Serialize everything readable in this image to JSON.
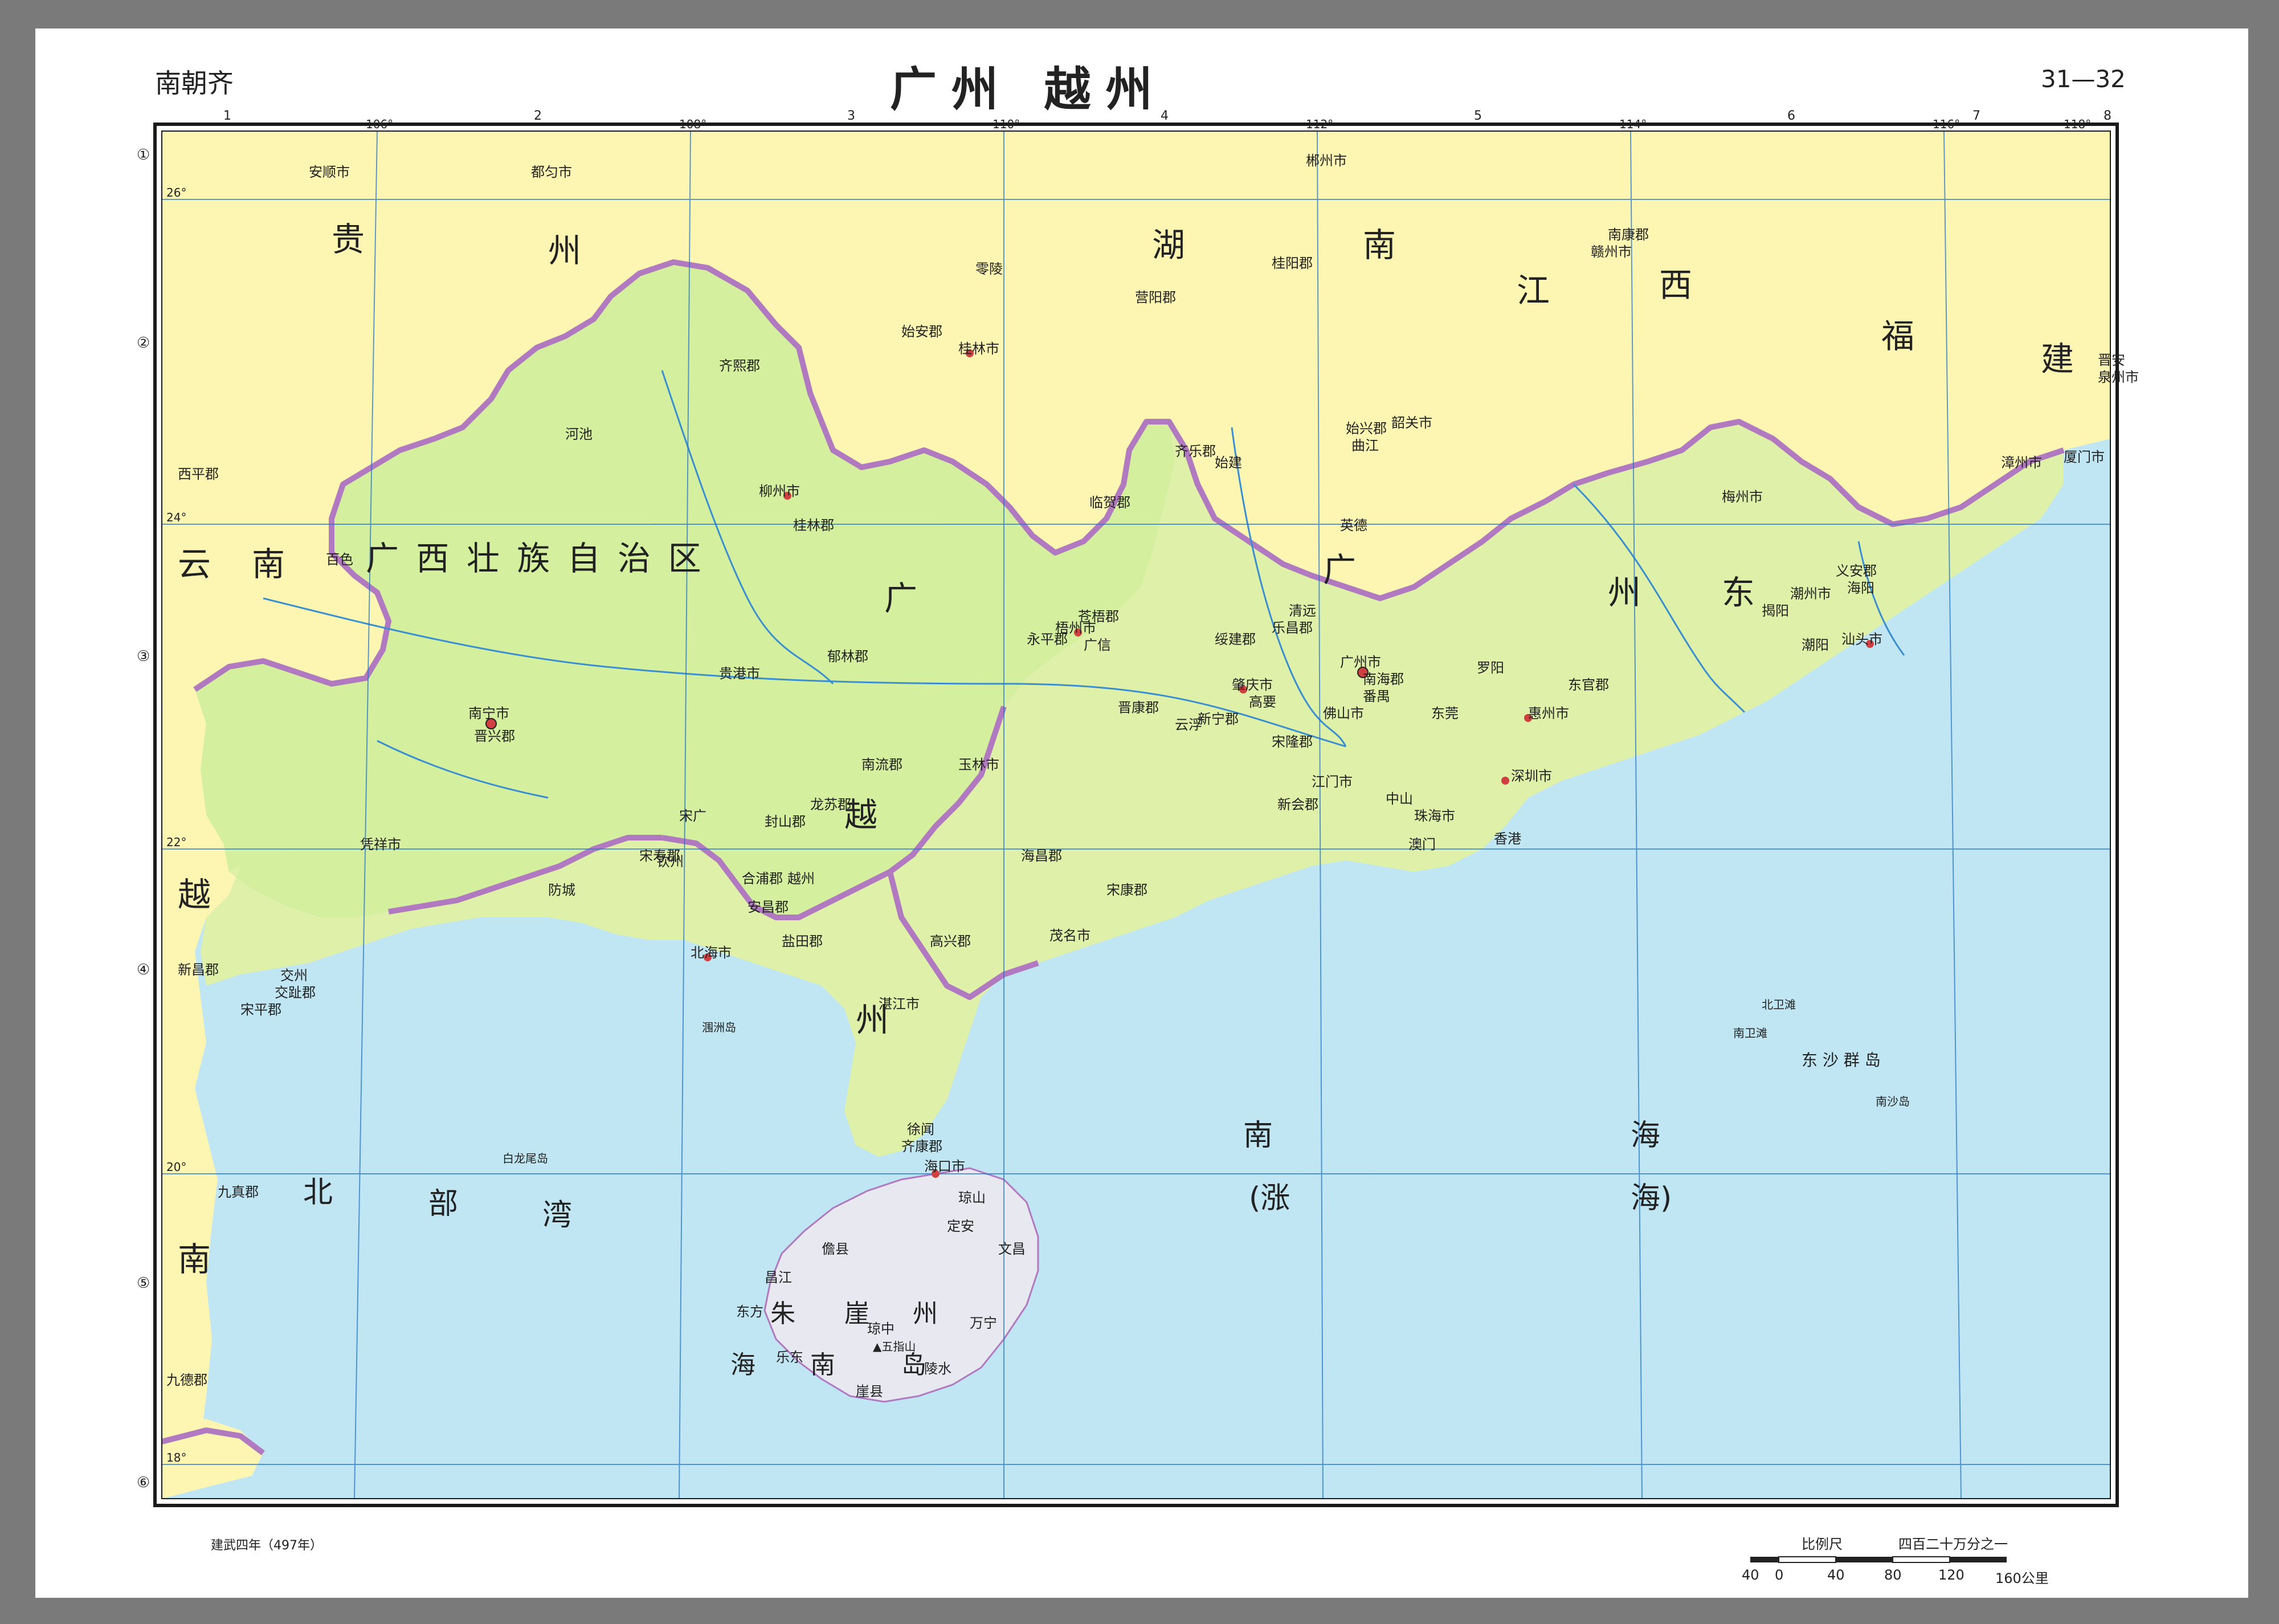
{
  "header": {
    "dynasty": "南朝齐",
    "title": "广州 越州",
    "page_no": "31—32"
  },
  "footer": {
    "note": "建武四年（497年）"
  },
  "scale": {
    "label": "比例尺",
    "ratio": "四百二十万分之一",
    "ticks": [
      "40",
      "0",
      "40",
      "80",
      "120",
      "160公里"
    ]
  },
  "grid": {
    "columns": [
      "1",
      "2",
      "3",
      "4",
      "5",
      "6",
      "7",
      "8"
    ],
    "rows": [
      "①",
      "②",
      "③",
      "④",
      "⑤",
      "⑥"
    ],
    "longitudes": [
      "106°",
      "108°",
      "110°",
      "112°",
      "114°",
      "116°",
      "118°"
    ],
    "latitudes": [
      "26°",
      "24°",
      "22°",
      "20°",
      "18°"
    ]
  },
  "colors": {
    "sea": "#bfe6f2",
    "land_outside": "#fdf6b2",
    "guangxi_region": "#d4ef9e",
    "guangdong_land": "#dff0a8",
    "hainan_island": "#e8e8f0",
    "province_border": "#b079c0",
    "river": "#3a8fd0",
    "frame": "#1a1a1a"
  },
  "regions": {
    "big_labels": [
      "广西壮族自治区",
      "广州",
      "越州",
      "湖南",
      "江西",
      "福建",
      "贵州",
      "云南",
      "南海",
      "(涨海)",
      "北部湾",
      "朱崖州",
      "海南岛",
      "东沙群岛"
    ],
    "guangxi": "广  西  壮  族  自  治  区",
    "guangdong_a": "广",
    "guangdong_b": "东",
    "guangzhou_a": "广",
    "guangzhou_b": "州",
    "yuezhou_a": "越",
    "yuezhou_b": "州",
    "hunan_a": "湖",
    "hunan_b": "南",
    "jiangxi_a": "江",
    "jiangxi_b": "西",
    "fujian_a": "福",
    "fujian_b": "建",
    "guizhou_a": "贵",
    "guizhou_b": "州",
    "yunnan_a": "云",
    "yunnan_b": "南",
    "yue_a": "越",
    "yue_b": "南",
    "nanhai_a": "南",
    "nanhai_b": "海",
    "zhanghai_a": "(涨",
    "zhanghai_b": "海)",
    "beibu_a": "北",
    "beibu_b": "部",
    "beibu_c": "湾",
    "zhuya_a": "朱",
    "zhuya_b": "崖",
    "zhuya_c": "州",
    "hainan_a": "海",
    "hainan_b": "南",
    "hainan_c": "岛",
    "dongsha": "东  沙  群  岛"
  },
  "places": {
    "guangzhou_city": "广州市",
    "nanhai_jun": "南海郡",
    "panyu": "番禺",
    "shenzhen": "深圳市",
    "xianggang": "香港",
    "aomen": "澳门",
    "zhuhai": "珠海市",
    "foshan": "佛山市",
    "jiangmen": "江门市",
    "zhongshan": "中山",
    "dongguan": "东莞",
    "huizhou": "惠州市",
    "shantou": "汕头市",
    "chaozhou": "潮州市",
    "chaoyang": "潮阳",
    "jieyang": "揭阳",
    "meizhou": "梅州市",
    "yian_jun": "义安郡",
    "haiyang": "海阳",
    "shaoguan": "韶关市",
    "shixing_jun": "始兴郡",
    "qujiang": "曲江",
    "yingde": "英德",
    "qingyuan": "清远",
    "zhaoqing": "肇庆市",
    "gaoyao": "高要",
    "yunfu": "云浮",
    "wuzhou": "梧州市",
    "cangwu": "苍梧郡",
    "guangxin": "广信",
    "maoming": "茂名市",
    "zhanjiang": "湛江市",
    "xuwen": "徐闻",
    "qikang_jun": "齐康郡",
    "nanning": "南宁市",
    "jinxing_jun": "晋兴郡",
    "liuzhou": "柳州市",
    "guilin": "桂林市",
    "shian_jun": "始安郡",
    "yulin": "玉林市",
    "guigang": "贵港市",
    "beihai": "北海市",
    "hepu_jun": "合浦郡",
    "qinzhou": "钦州",
    "fangcheng": "防城",
    "pingxiang": "凭祥市",
    "baise": "百色",
    "hechi": "河池",
    "haikou": "海口市",
    "qiongshan": "琼山",
    "danxian": "儋县",
    "sanya": "崖县",
    "lingshui": "陵水",
    "wanning": "万宁",
    "wenchang": "文昌",
    "dingan": "定安",
    "changjiang": "昌江",
    "dongfang": "东方",
    "ledong": "乐东",
    "qiongzhong": "琼中",
    "wuzhishan": "▲五指山",
    "jiaozhi": "交趾郡",
    "jiaozhou": "交州",
    "xinchang": "新昌郡",
    "songping": "宋平郡",
    "jiude": "九德郡",
    "jiuzhen": "九真郡",
    "chenzhou": "郴州市",
    "guiyang_jun": "桂阳郡",
    "lingling": "零陵",
    "yingyang": "营阳郡",
    "ganzhou": "赣州市",
    "nankang": "南康郡",
    "quanzhou": "泉州市",
    "xiamen": "厦门市",
    "zhangzhou": "漳州市",
    "jinjiang": "晋安",
    "anshun": "安顺市",
    "duyun": "都匀市",
    "xiyang": "西平郡",
    "bailongwei": "白龙尾岛",
    "weizhou": "涠洲岛",
    "nansha": "南沙岛",
    "beiwei": "北卫滩",
    "nanweitan": "南卫滩",
    "songshou": "宋寿郡",
    "songguang": "宋广",
    "gaoxing": "高兴郡",
    "haichang": "海昌郡",
    "xinning": "新宁郡",
    "xinhui": "新会郡",
    "songlong": "宋隆郡",
    "suijian": "绥建郡",
    "leping": "乐昌郡",
    "songkang": "宋康郡",
    "yongping": "永平郡",
    "yulin_jun": "郁林郡",
    "guiling": "桂林郡",
    "linhe": "临贺郡",
    "shijian": "始建",
    "qixi": "齐熙郡",
    "qile": "齐乐郡",
    "dongguan_jun": "东官郡",
    "lingnan": "罗阳",
    "jinkang": "晋康郡",
    "nanliu": "南流郡",
    "longsu": "龙苏郡",
    "fengshan": "封山郡",
    "yanhe": "盐田郡",
    "anjing": "安昌郡",
    "yuezhou_city": "越州"
  }
}
